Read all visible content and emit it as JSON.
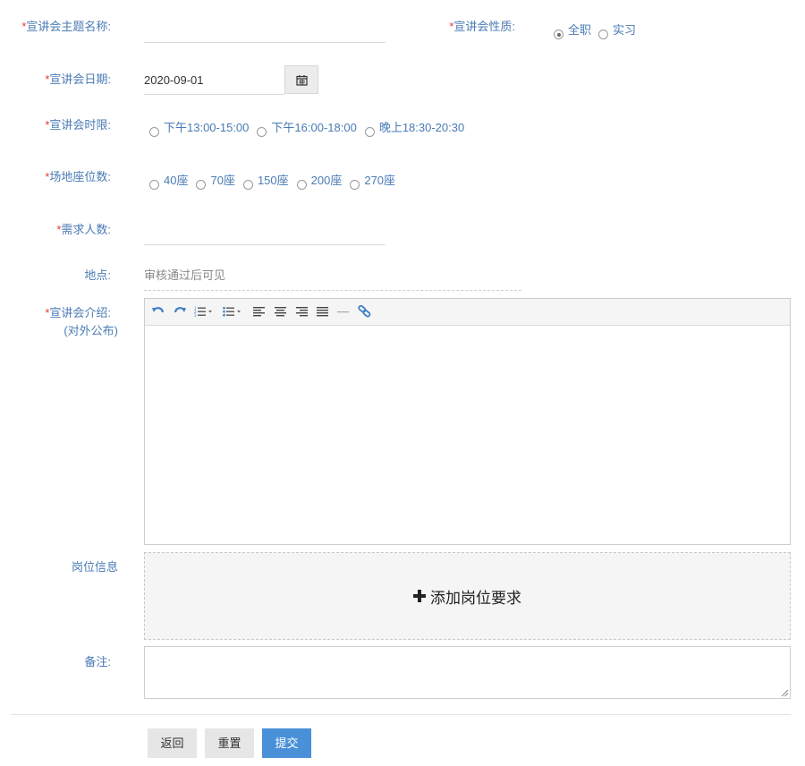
{
  "form": {
    "topic": {
      "required_mark": "*",
      "label": "宣讲会主题名称:",
      "value": ""
    },
    "nature": {
      "required_mark": "*",
      "label": "宣讲会性质:",
      "options": [
        "全职",
        "实习"
      ],
      "selected": "全职"
    },
    "date": {
      "required_mark": "*",
      "label": "宣讲会日期:",
      "value": "2020-09-01"
    },
    "time_slot": {
      "required_mark": "*",
      "label": "宣讲会时限:",
      "options": [
        "下午13:00-15:00",
        "下午16:00-18:00",
        "晚上18:30-20:30"
      ]
    },
    "seats": {
      "required_mark": "*",
      "label": "场地座位数:",
      "options": [
        "40座",
        "70座",
        "150座",
        "200座",
        "270座"
      ]
    },
    "headcount": {
      "required_mark": "*",
      "label": "需求人数:",
      "value": ""
    },
    "location": {
      "label": "地点:",
      "value": "审核通过后可见"
    },
    "intro": {
      "required_mark": "*",
      "label": "宣讲会介绍:",
      "label_sub": "(对外公布)"
    },
    "positions": {
      "label": "岗位信息",
      "add_label": "添加岗位要求"
    },
    "remark": {
      "label": "备注:",
      "value": ""
    }
  },
  "editor_toolbar": [
    "undo-icon",
    "redo-icon",
    "ordered-list-icon",
    "unordered-list-icon",
    "align-left-icon",
    "align-center-icon",
    "align-right-icon",
    "align-justify-icon",
    "horizontal-rule-icon",
    "link-icon"
  ],
  "buttons": {
    "back": "返回",
    "reset": "重置",
    "submit": "提交"
  },
  "colors": {
    "label": "#4a7bb4",
    "required": "#e23b3b",
    "submit_bg": "#4a90d9",
    "secondary_bg": "#e6e6e6"
  }
}
